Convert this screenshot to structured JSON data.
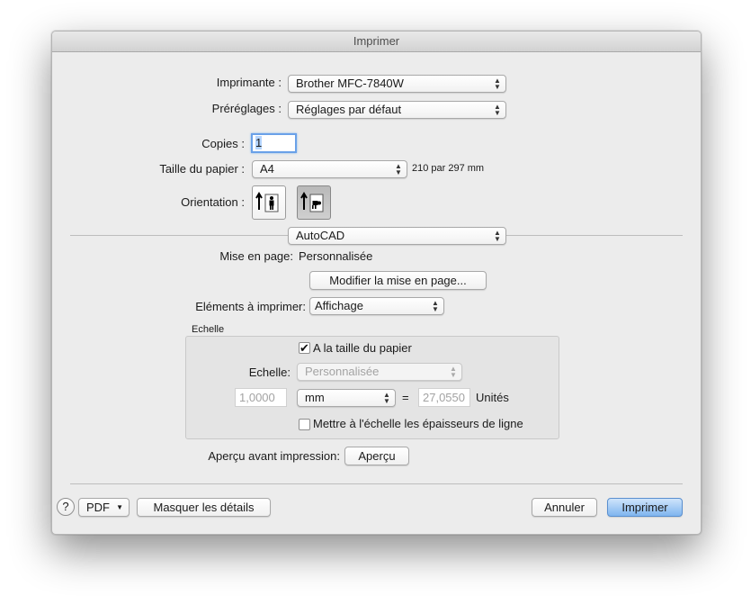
{
  "window": {
    "title": "Imprimer"
  },
  "printer": {
    "label": "Imprimante :",
    "value": "Brother MFC-7840W"
  },
  "presets": {
    "label": "Préréglages :",
    "value": "Réglages par défaut"
  },
  "copies": {
    "label": "Copies :",
    "value": "1"
  },
  "paper": {
    "label": "Taille du papier :",
    "value": "A4",
    "dimensions": "210 par 297 mm"
  },
  "orientation": {
    "label": "Orientation :",
    "options": [
      "portrait",
      "landscape"
    ],
    "selected": "landscape"
  },
  "section": {
    "value": "AutoCAD"
  },
  "page_setup": {
    "label": "Mise en page:",
    "value": "Personnalisée",
    "modify_button": "Modifier la mise en page..."
  },
  "elements": {
    "label": "Eléments à imprimer:",
    "value": "Affichage"
  },
  "scale_group": {
    "title": "Echelle",
    "fit_paper": {
      "label": "A la taille du papier",
      "checked": true
    },
    "scale": {
      "label": "Echelle:",
      "value": "Personnalisée"
    },
    "left_value": "1,0000",
    "unit": "mm",
    "equals": "=",
    "right_value": "27,0550",
    "units_label": "Unités",
    "lineweights": {
      "label": "Mettre à l'échelle les épaisseurs de ligne",
      "checked": false
    }
  },
  "preview": {
    "label": "Aperçu avant impression:",
    "button": "Aperçu"
  },
  "footer": {
    "help": "?",
    "pdf": "PDF",
    "hide_details": "Masquer les détails",
    "cancel": "Annuler",
    "print": "Imprimer"
  },
  "colors": {
    "accent": "#7fb5ef",
    "window_bg": "#ececec",
    "focus": "#6aa1e8"
  }
}
